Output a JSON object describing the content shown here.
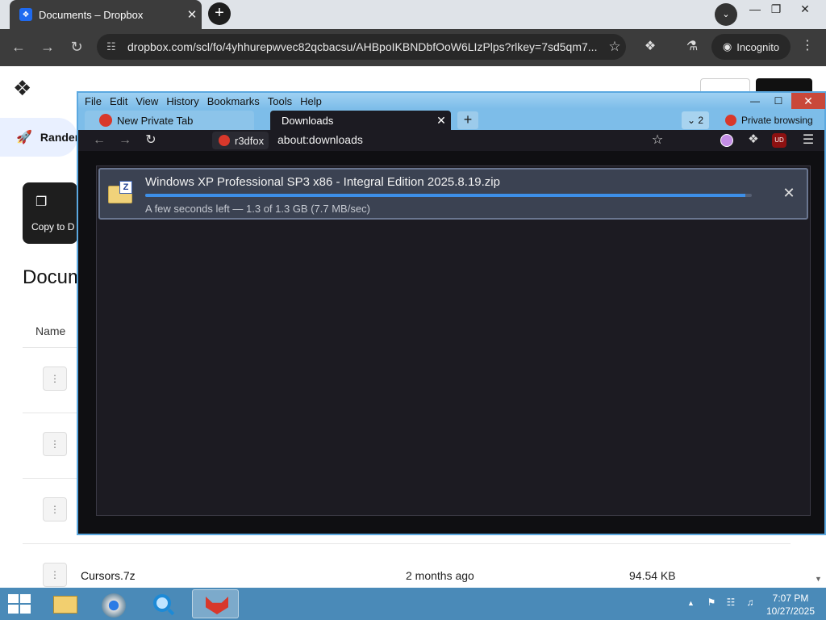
{
  "chrome": {
    "tab_title": "Documents – Dropbox",
    "tab_favicon": "dropbox-icon",
    "url": "dropbox.com/scl/fo/4yhhurepwvec82qcbacsu/AHBpoIKBNDbfOoW6LIzPlps?rlkey=7sd5qm7...",
    "incognito_label": "Incognito",
    "icons": {
      "back": "←",
      "forward": "→",
      "reload": "↻",
      "new_tab": "+",
      "tab_close": "✕",
      "tab_search": "⌄",
      "minimize": "—",
      "maximize": "❐",
      "close": "✕",
      "site_settings": "☷",
      "bookmark": "☆",
      "extensions": "❖",
      "labs": "⚗",
      "incognito": "◉",
      "menu": "⋮"
    }
  },
  "dropbox": {
    "logo_icon": "❖",
    "sidebar_item_label": "Randen",
    "sidebar_item_icon": "rocket-icon",
    "sidebar_item_glyph": "🚀",
    "copy_label": "Copy to D",
    "copy_icon": "❐",
    "page_title": "Docum",
    "name_header": "Name",
    "file_row": {
      "name": "Cursors.7z",
      "modified": "2 months ago",
      "size": "94.54 KB"
    },
    "zip_glyph": "⋮",
    "scroll_down": "▼"
  },
  "firefox": {
    "menu": [
      "File",
      "Edit",
      "View",
      "History",
      "Bookmarks",
      "Tools",
      "Help"
    ],
    "menu_accel": [
      "F",
      "E",
      "V",
      "s",
      "B",
      "T",
      "H"
    ],
    "window_controls": {
      "minimize": "—",
      "maximize": "☐",
      "close": "✕"
    },
    "tabs": [
      {
        "label": "New Private Tab",
        "active": false
      },
      {
        "label": "Downloads",
        "active": true
      }
    ],
    "tab_close": "✕",
    "new_tab": "+",
    "tab_count": "⌄ 2",
    "private_label": "Private browsing",
    "identity_label": "r3dfox",
    "url": "about:downloads",
    "ublock_label": "UD",
    "nav_icons": {
      "back": "←",
      "forward": "→",
      "reload": "↻",
      "star": "☆",
      "extensions": "❖",
      "menu": "☰"
    },
    "download": {
      "filename": "Windows XP Professional SP3 x86 - Integral Edition 2025.8.19.zip",
      "status": "A few seconds left — 1.3 of 1.3 GB (7.7 MB/sec)",
      "progress_fraction": 0.99,
      "file_icon_letter": "Z",
      "cancel_icon": "✕"
    }
  },
  "taskbar": {
    "time": "7:07 PM",
    "date": "10/27/2025",
    "tray_arrow": "▲",
    "tray_flag": "⚑",
    "tray_network": "☷",
    "tray_volume": "♫",
    "buttons": [
      "file-explorer",
      "chrome",
      "magnifier",
      "r3dfox"
    ]
  },
  "colors": {
    "progress": "#3d8fe8",
    "firefox_frame": "#5ba8e0",
    "taskbar": "#4a8ab8",
    "close_button": "#c9483a"
  }
}
